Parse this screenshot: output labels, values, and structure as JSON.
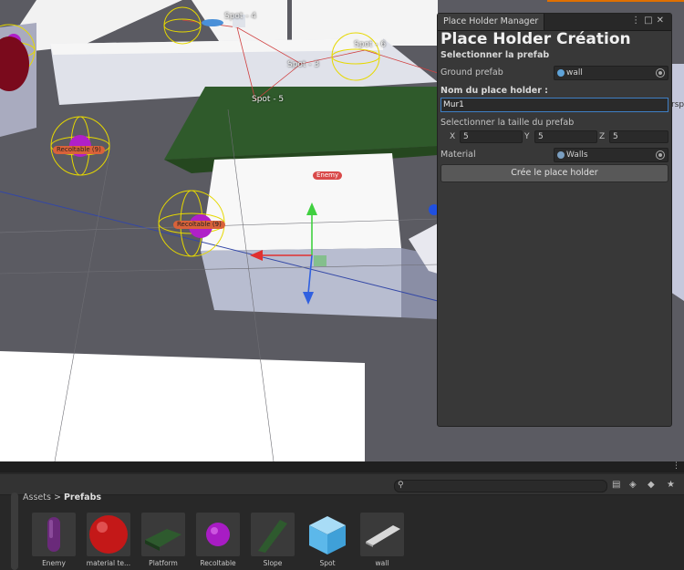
{
  "scene": {
    "spots": [
      "Spot - 4",
      "Spot - 3",
      "Spot - 5",
      "Spot - 6"
    ],
    "tags": [
      "Recoltable (9)",
      "Recoltable (9)",
      "Enemy"
    ],
    "edge_label": "rsp"
  },
  "place_holder_manager": {
    "tab_title": "Place Holder Manager",
    "heading": "Place Holder Création",
    "select_prefab": "Selectionner la prefab",
    "ground_prefab_label": "Ground prefab",
    "ground_prefab_value": "wall",
    "name_label": "Nom du place holder :",
    "name_value": "Mur1",
    "size_label": "Selectionner la taille du prefab",
    "size": {
      "x_label": "X",
      "x": "5",
      "y_label": "Y",
      "y": "5",
      "z_label": "Z",
      "z": "5"
    },
    "material_label": "Material",
    "material_value": "Walls",
    "create_button": "Crée le place holder"
  },
  "project": {
    "breadcrumb_root": "Assets",
    "breadcrumb_sep": ">",
    "breadcrumb_current": "Prefabs",
    "assets": [
      {
        "name": "Enemy",
        "icon": "capsule-icon"
      },
      {
        "name": "material te...",
        "icon": "sphere-red-icon"
      },
      {
        "name": "Platform",
        "icon": "platform-icon"
      },
      {
        "name": "Recoltable",
        "icon": "sphere-purple-icon"
      },
      {
        "name": "Slope",
        "icon": "slope-icon"
      },
      {
        "name": "Spot",
        "icon": "cube-icon"
      },
      {
        "name": "wall",
        "icon": "wall-icon"
      }
    ]
  }
}
